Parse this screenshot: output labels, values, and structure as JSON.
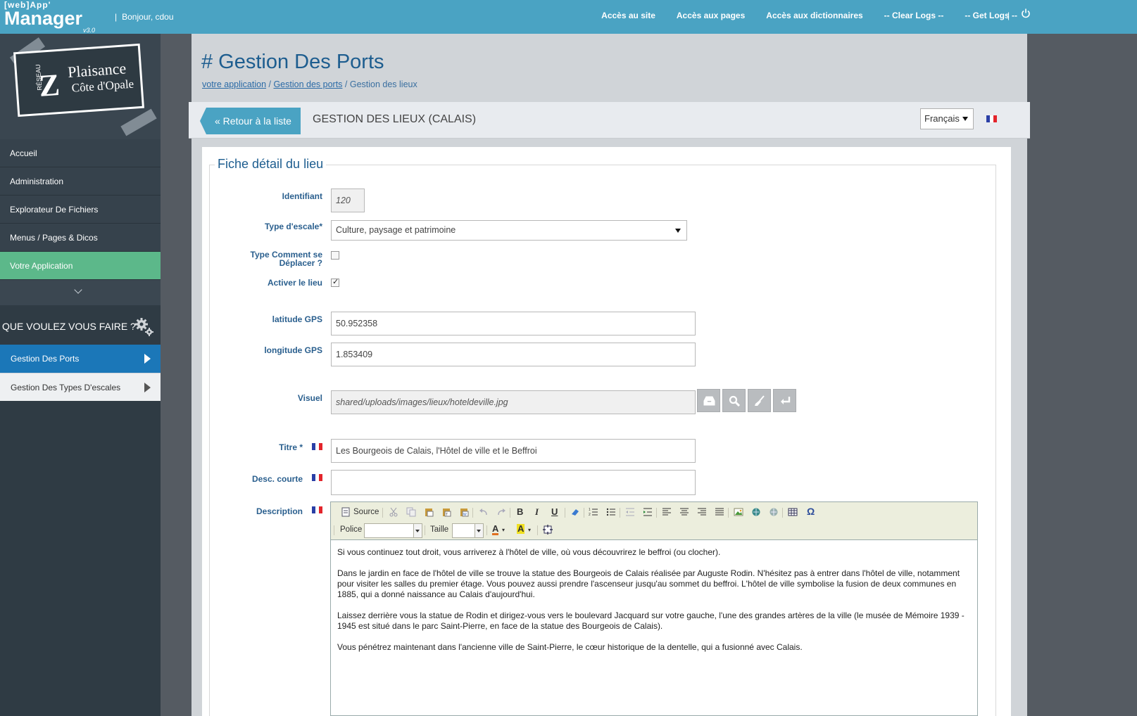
{
  "header": {
    "brand_small": "[web]App'",
    "brand_big": "Manager",
    "brand_version": "v3.0",
    "greeting": "Bonjour, cdou",
    "nav": [
      "Accès au site",
      "Accès aux pages",
      "Accès aux dictionnaires",
      "-- Clear Logs --",
      "-- Get Logs --"
    ],
    "power_icon": "power-icon"
  },
  "logo": {
    "line1": "Plaisance",
    "line2": "Côte d'Opale",
    "side": "RÉSEAU"
  },
  "sidebar": {
    "items": [
      "Accueil",
      "Administration",
      "Explorateur De Fichiers",
      "Menus / Pages & Dicos",
      "Votre Application"
    ],
    "active_index": 4,
    "ask_title": "QUE VOULEZ VOUS FAIRE ?",
    "sub_items": [
      "Gestion Des Ports",
      "Gestion Des Types D'escales"
    ],
    "sub_selected_index": 0
  },
  "page": {
    "title": "# Gestion Des Ports",
    "breadcrumb": {
      "link1": "votre application",
      "link2": "Gestion des ports",
      "current": "Gestion des lieux"
    },
    "back_label": "« Retour à la liste",
    "section_title": "GESTION DES LIEUX (CALAIS)",
    "language": "Français"
  },
  "form": {
    "legend": "Fiche détail du lieu",
    "id_label": "Identifiant",
    "id_value": "120",
    "type_label": "Type d'escale*",
    "type_value": "Culture, paysage et patrimoine",
    "move_label_1": "Type Comment se",
    "move_label_2": "Déplacer ?",
    "move_checked": false,
    "active_label": "Activer le lieu",
    "active_checked": true,
    "lat_label": "latitude GPS",
    "lat_value": "50.952358",
    "lng_label": "longitude GPS",
    "lng_value": "1.853409",
    "visual_label": "Visuel",
    "visual_value": "shared/uploads/images/lieux/hoteldeville.jpg",
    "title_label": "Titre *",
    "title_value": "Les Bourgeois de Calais, l'Hôtel de ville et le Beffroi",
    "desc_short_label": "Desc. courte",
    "desc_short_value": "",
    "description_label": "Description"
  },
  "editor": {
    "source_label": "Source",
    "font_label": "Police",
    "size_label": "Taille",
    "paragraphs": [
      "Si vous continuez tout droit, vous arriverez à l'hôtel de ville, où vous découvrirez le beffroi (ou clocher).",
      "Dans le jardin en face de l'hôtel de ville se trouve la statue des Bourgeois de Calais réalisée par Auguste Rodin. N'hésitez pas à entrer dans l'hôtel de ville, notamment pour visiter les salles du premier étage. Vous pouvez aussi prendre l'ascenseur jusqu'au sommet du beffroi. L'hôtel de ville symbolise la fusion de deux communes en 1885, qui a donné naissance au Calais d'aujourd'hui.",
      "Laissez derrière vous la statue de Rodin et dirigez-vous vers le boulevard Jacquard sur votre gauche, l'une des grandes artères de la ville (le musée de Mémoire 1939 - 1945 est situé dans le parc Saint-Pierre, en face de la statue des Bourgeois de Calais).",
      "Vous pénétrez maintenant dans l'ancienne ville de Saint-Pierre, le cœur historique de la dentelle, qui a fusionné avec Calais."
    ]
  },
  "colors": {
    "topbar": "#4aa3c3",
    "sidebar": "#2f3b44",
    "active": "#5cb88a",
    "selected": "#1b77b8",
    "title": "#1d5d8f"
  }
}
